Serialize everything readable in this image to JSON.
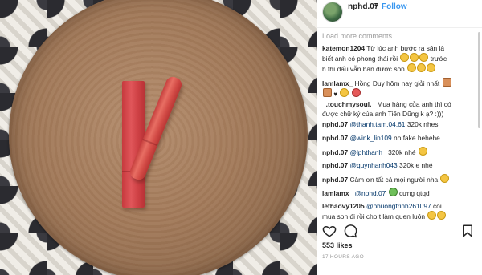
{
  "post": {
    "username": "nphd.07",
    "separator": "•",
    "follow_label": "Follow"
  },
  "comments": {
    "load_more": "Load more comments",
    "items": [
      {
        "user": "katemon1204",
        "line1": "Từ lúc anh bước ra sân là",
        "line2": "biết anh có phong thái rồi",
        "after_emoji": "trước",
        "line3": "h thì đấu vẫn bán được son"
      },
      {
        "user": "lamlamx_",
        "text": "Hồng Duy hôm nay giỏi nhất"
      },
      {
        "user": "_.touchmysoul._",
        "line1": "Mua hàng của anh thì có",
        "line2": "được chữ ký của anh Tiến Dũng k ạ? :)))"
      },
      {
        "user": "nphd.07",
        "mention": "@thanh.tam.04.61",
        "text": "320k nhes"
      },
      {
        "user": "nphd.07",
        "mention": "@wink_lin109",
        "text": "no fake hehehe"
      },
      {
        "user": "nphd.07",
        "mention": "@lphthanh_",
        "text": "320k nhé"
      },
      {
        "user": "nphd.07",
        "mention": "@quynhanh043",
        "text": "320k e nhé"
      },
      {
        "user": "nphd.07",
        "text": "Cảm ơn tất cả mọi người nha"
      },
      {
        "user": "lamlamx_",
        "mention": "@nphd.07",
        "text": "cưng qtqd"
      },
      {
        "user": "lethaovy1205",
        "mention": "@phuongtrinh261097",
        "after": "coi",
        "line2": "mua son đi rồi cho t làm quen luôn"
      }
    ]
  },
  "icons": {
    "avatar": "avatar",
    "heart": "heart-icon",
    "comment": "comment-icon",
    "bookmark": "bookmark-icon",
    "emoji": "emoji-icons"
  },
  "stats": {
    "likes": "553 likes",
    "time": "17 HOURS AGO"
  },
  "colors": {
    "link": "#3897f0",
    "text": "#262626",
    "muted": "#999999",
    "lipstick": "#d84a48"
  }
}
